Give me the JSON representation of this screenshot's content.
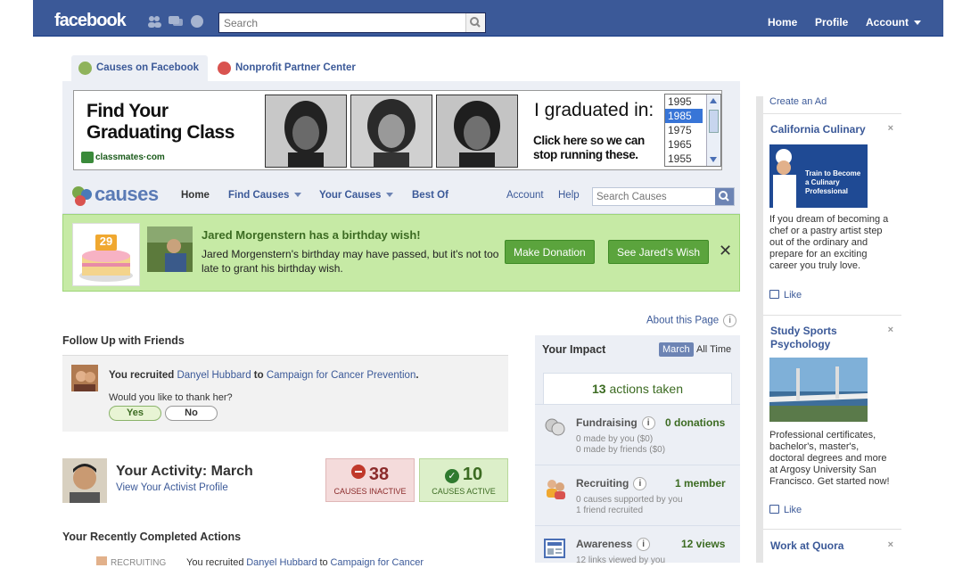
{
  "topbar": {
    "logo": "facebook",
    "search_placeholder": "Search",
    "nav": [
      "Home",
      "Profile",
      "Account"
    ]
  },
  "tabs": [
    "Causes on Facebook",
    "Nonprofit Partner Center"
  ],
  "banner": {
    "headline": "Find Your Graduating Class",
    "brand": "classmates·com",
    "prompt": "I graduated in:",
    "cta": "Click here so we can stop running these.",
    "years": [
      "1995",
      "1985",
      "1975",
      "1965",
      "1955"
    ],
    "selected_year": "1985"
  },
  "causes_nav": {
    "logo": "causes",
    "items": [
      "Home",
      "Find Causes",
      "Your Causes",
      "Best Of"
    ],
    "right": [
      "Account",
      "Help"
    ],
    "search_placeholder": "Search Causes"
  },
  "birthday": {
    "cake_number": "29",
    "title": "Jared Morgenstern has a birthday wish!",
    "text": "Jared Morgenstern's birthday may have passed, but it's not too late to grant his birthday wish.",
    "donate": "Make Donation",
    "wish": "See Jared's Wish",
    "close": "✕"
  },
  "about": "About this Page",
  "follow": {
    "heading": "Follow Up with Friends",
    "you_recruited": "You recruited",
    "person": "Danyel Hubbard",
    "to": "to",
    "cause": "Campaign for Cancer Prevention",
    "period": ".",
    "question": "Would you like to thank her?",
    "yes": "Yes",
    "no": "No"
  },
  "activity": {
    "title": "Your Activity: March",
    "link": "View Your Activist Profile",
    "inactive_count": "38",
    "inactive_label": "CAUSES INACTIVE",
    "active_count": "10",
    "active_label": "CAUSES ACTIVE"
  },
  "recent": {
    "heading": "Your Recently Completed Actions",
    "tag": "RECRUITING",
    "text": "You recruited",
    "person": "Danyel Hubbard",
    "to": "to",
    "cause": "Campaign for Cancer"
  },
  "impact": {
    "title": "Your Impact",
    "tab_month": "March",
    "tab_all": "All Time",
    "actions_count": "13",
    "actions_label": "actions taken",
    "fundraising": {
      "label": "Fundraising",
      "value": "0 donations",
      "l1": "0 made by you ($0)",
      "l2": "0 made by friends ($0)"
    },
    "recruiting": {
      "label": "Recruiting",
      "value": "1 member",
      "l1": "0 causes supported by you",
      "l2": "1 friend recruited"
    },
    "awareness": {
      "label": "Awareness",
      "value": "12 views",
      "l1": "12 links viewed by you"
    }
  },
  "sidebar": {
    "create_ad": "Create an Ad",
    "ads": [
      {
        "title": "California Culinary",
        "image_text": "Train to Become a Culinary Professional",
        "text": "If you dream of becoming a chef or a pastry artist step out of the ordinary and prepare for an exciting career you truly love.",
        "like": "Like"
      },
      {
        "title": "Study Sports Psychology",
        "text": "Professional certificates, bachelor's, master's, doctoral degrees and more at Argosy University San Francisco. Get started now!",
        "like": "Like"
      },
      {
        "title": "Work at Quora"
      }
    ],
    "close": "×"
  },
  "colors": {
    "facebook_blue": "#3b5998",
    "green": "#5ba43d",
    "red": "#c0392b"
  }
}
